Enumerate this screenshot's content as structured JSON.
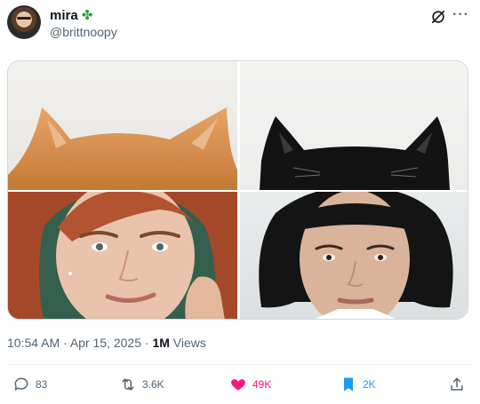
{
  "post": {
    "author": {
      "display_name": "mira",
      "name_emoji": "✤",
      "handle": "@brittnoopy"
    },
    "header_icons": [
      "grok-icon",
      "more-icon"
    ],
    "timestamp": "10:54 AM · Apr 15, 2025",
    "separator": " · ",
    "views_count": "1M",
    "views_label": " Views",
    "stats": {
      "replies": "83",
      "reposts": "3.6K",
      "likes": "49K",
      "bookmarks": "2K"
    },
    "colors": {
      "like_active": "#f91880",
      "bookmark_active": "#1d9bf0",
      "muted_text": "#536471"
    }
  }
}
